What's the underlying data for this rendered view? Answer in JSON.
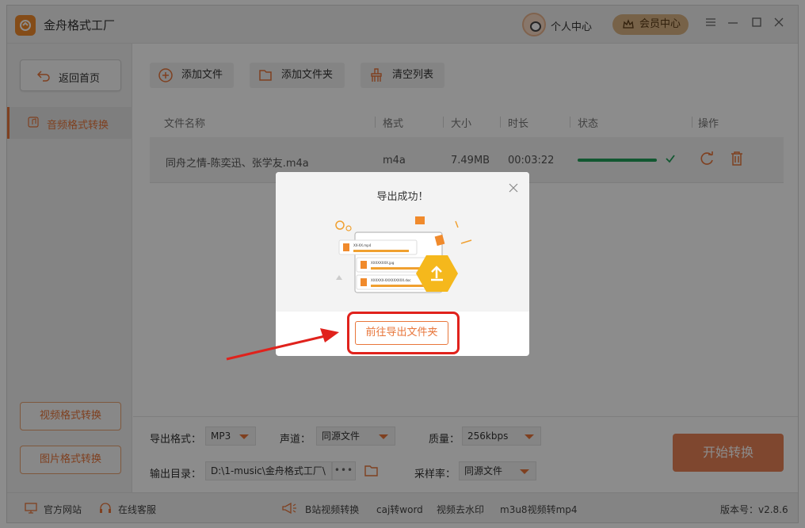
{
  "app": {
    "title": "金舟格式工厂",
    "user_center": "个人中心",
    "vip_center": "会员中心"
  },
  "sidebar": {
    "back_home": "返回首页",
    "audio_convert": "音频格式转换",
    "video_convert": "视频格式转换",
    "image_convert": "图片格式转换"
  },
  "toolbar": {
    "add_file": "添加文件",
    "add_folder": "添加文件夹",
    "clear_list": "清空列表"
  },
  "table": {
    "headers": [
      "文件名称",
      "格式",
      "大小",
      "时长",
      "状态",
      "操作"
    ],
    "rows": [
      {
        "name": "同舟之情-陈奕迅、张学友.m4a",
        "format": "m4a",
        "size": "7.49MB",
        "duration": "00:03:22",
        "progress": 1.0
      }
    ]
  },
  "settings": {
    "output_format_label": "导出格式：",
    "output_format_value": "MP3",
    "channel_label": "声道：",
    "channel_value": "同源文件",
    "quality_label": "质量：",
    "quality_value": "256kbps",
    "output_dir_label": "输出目录：",
    "output_dir_value": "D:\\1-music\\金舟格式工厂\\",
    "browse_dots": "•••",
    "sample_rate_label": "采样率：",
    "sample_rate_value": "同源文件",
    "start_button": "开始转换"
  },
  "statusbar": {
    "official_site": "官方网站",
    "online_service": "在线客服",
    "links": [
      "B站视频转换",
      "caj转word",
      "视频去水印",
      "m3u8视频转mp4"
    ],
    "version": "版本号：v2.8.6"
  },
  "modal": {
    "title": "导出成功！",
    "open_folder_button": "前往导出文件夹",
    "illus_files": [
      "XX-XX.mp4",
      "XXXXXXXX.jpg",
      "XXXXXX-XXXXXXXXX.doc"
    ]
  },
  "colors": {
    "accent": "#e8763b",
    "success": "#22a05a",
    "highlight": "#e0221c"
  }
}
